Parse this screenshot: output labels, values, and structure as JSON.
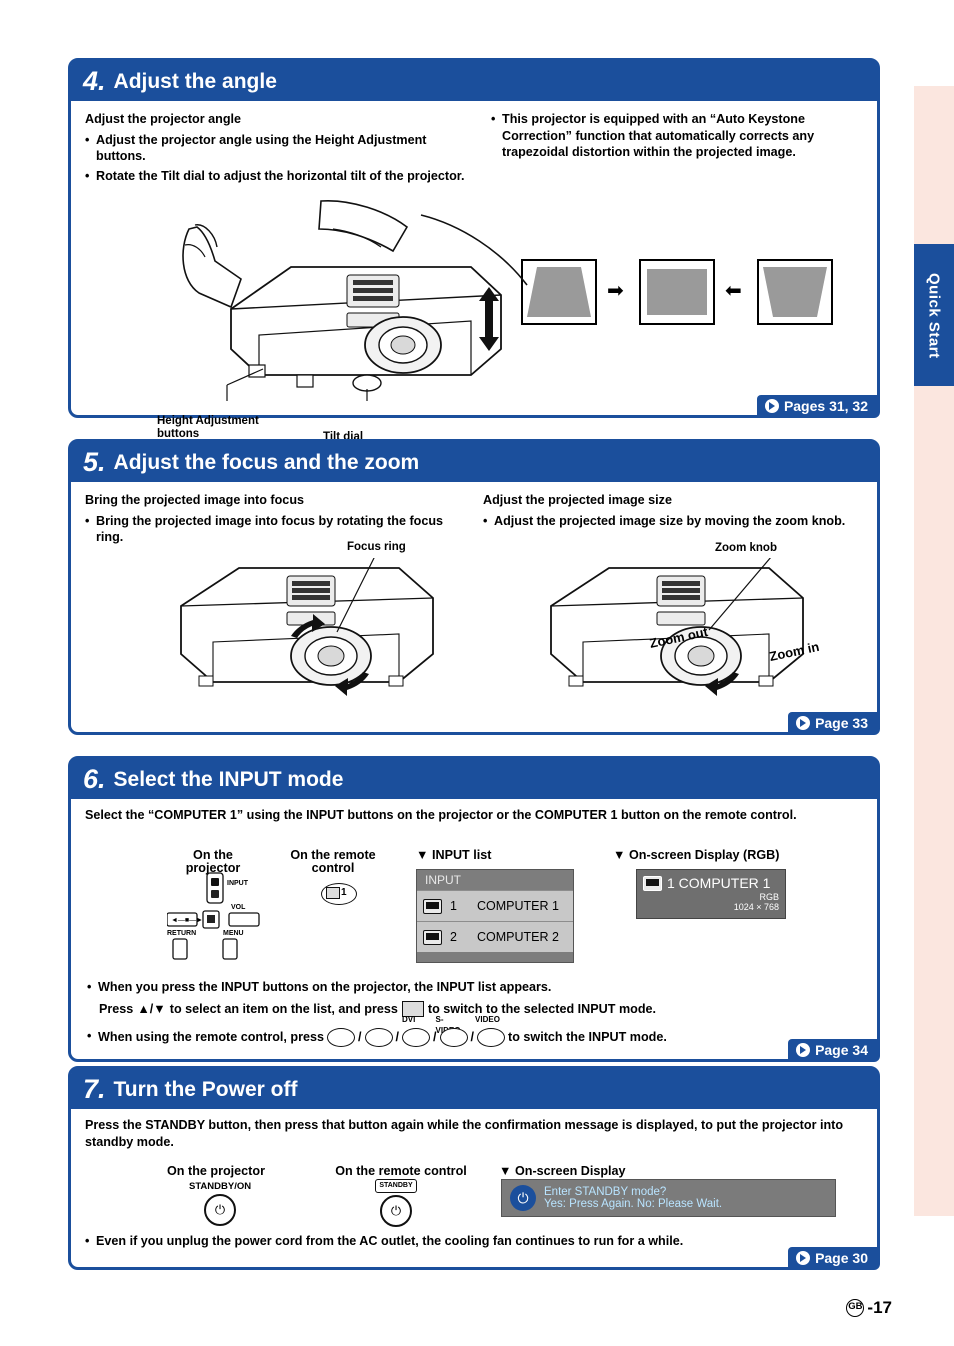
{
  "side_tab": {
    "label": "Quick Start"
  },
  "footer": {
    "region": "GB",
    "page": "-17"
  },
  "sections": [
    {
      "number": "4.",
      "title": "Adjust the angle",
      "left": {
        "heading": "Adjust the projector angle",
        "bullets": [
          "Adjust the projector angle using the Height Adjustment buttons.",
          "Rotate the Tilt dial to adjust the horizontal tilt of the projector."
        ],
        "labels": {
          "height_buttons": "Height Adjustment\nbuttons",
          "height_buttons_line1": "Height Adjustment",
          "height_buttons_line2": "buttons",
          "tilt_dial": "Tilt dial"
        }
      },
      "right": {
        "bullet": "This projector is equipped with an “Auto Keystone Correction” function that automatically corrects any trapezoidal distortion within the projected image."
      },
      "pageref": "Pages 31, 32"
    },
    {
      "number": "5.",
      "title": "Adjust the focus and the zoom",
      "left": {
        "heading": "Bring the projected image into focus",
        "bullet": "Bring the projected image into focus by rotating the focus ring.",
        "label": "Focus ring"
      },
      "right": {
        "heading": "Adjust the projected image size",
        "bullet": "Adjust the projected image size by moving the zoom knob.",
        "label": "Zoom knob",
        "zoom_out": "Zoom out",
        "zoom_in": "Zoom in"
      },
      "pageref": "Page 33"
    },
    {
      "number": "6.",
      "title": "Select the INPUT mode",
      "intro": "Select the “COMPUTER 1” using the INPUT buttons on the projector or the COMPUTER 1 button on the remote control.",
      "columns": [
        {
          "line1": "On the",
          "line2": "projector"
        },
        {
          "line1": "On the remote",
          "line2": "control"
        },
        {
          "label": "INPUT list"
        },
        {
          "label": "On-screen Display (RGB)"
        }
      ],
      "projector_panel": {
        "input": "INPUT",
        "vol": "VOL",
        "return": "RETURN",
        "menu": "MENU"
      },
      "input_list": {
        "header": "INPUT",
        "rows": [
          {
            "num": "1",
            "name": "COMPUTER 1"
          },
          {
            "num": "2",
            "name": "COMPUTER 2"
          }
        ]
      },
      "osd_rgb": {
        "title": "1 COMPUTER 1",
        "signal": "RGB",
        "resolution": "1024 × 768"
      },
      "notes": [
        "When you press the INPUT buttons on the projector, the INPUT list appears.",
        "When using the remote control, press",
        "to switch the INPUT mode."
      ],
      "note_press_prefix": "Press",
      "note_press_mid": "to select an item on the list, and press",
      "note_press_suffix": "to switch to the selected INPUT mode.",
      "remote_keys": [
        "DVI",
        "S-VIDEO",
        "VIDEO"
      ],
      "pageref": "Page 34"
    },
    {
      "number": "7.",
      "title": "Turn the Power off",
      "intro": "Press the STANDBY button, then press that button again while the confirmation message is displayed, to put the projector into standby mode.",
      "columns": [
        {
          "label": "On the projector"
        },
        {
          "label": "On the remote control"
        },
        {
          "label": "On-screen Display"
        }
      ],
      "projector_button_label": "STANDBY/ON",
      "remote_button_label": "STANDBY",
      "osd": {
        "line1": "Enter STANDBY mode?",
        "line2": "Yes: Press Again.  No: Please Wait."
      },
      "note": "Even if you unplug the power cord from the AC outlet, the cooling fan continues to run for a while.",
      "pageref": "Page 30"
    }
  ]
}
